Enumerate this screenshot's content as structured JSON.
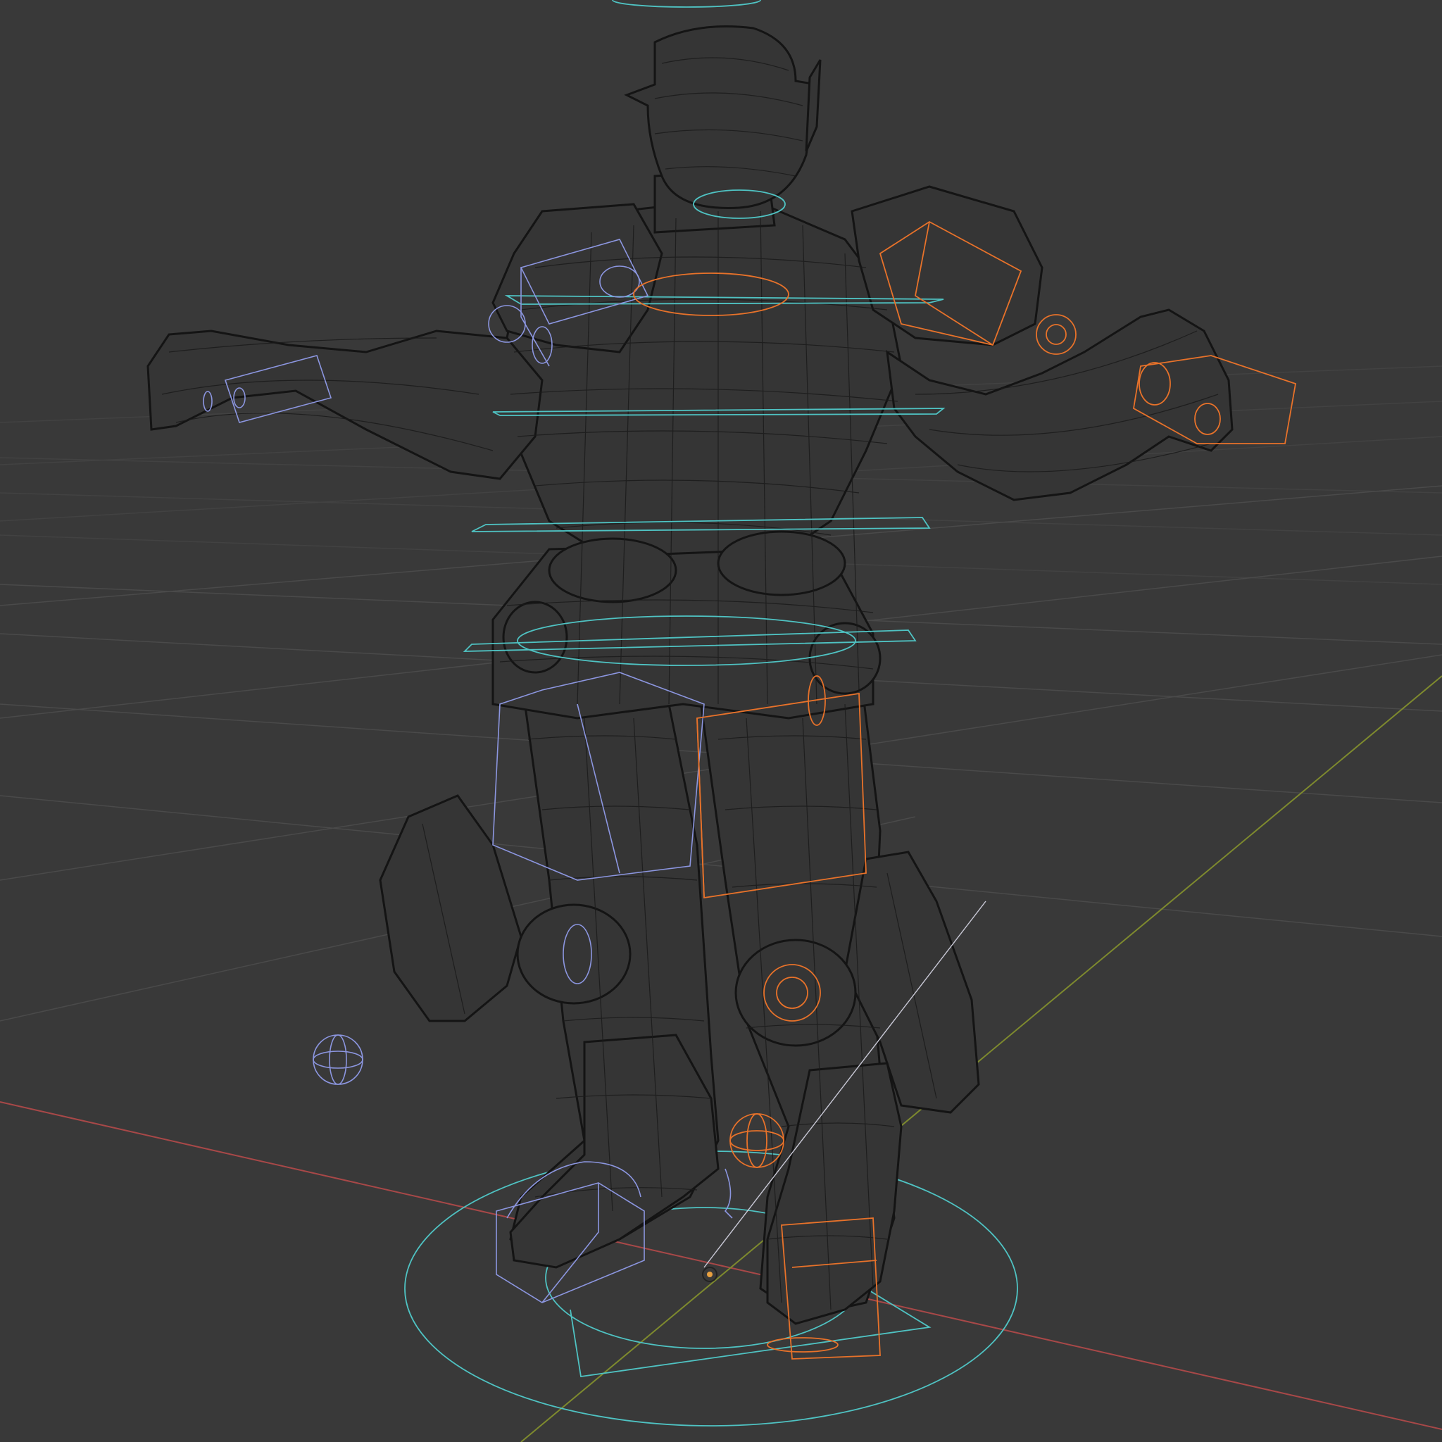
{
  "viewport": {
    "shading_mode": "wireframe",
    "background_color": "#393939",
    "grid_color": "#4a4a4a",
    "axis_colors": {
      "x": "#a84848",
      "y": "#7e8a2e"
    },
    "mesh_wire_color": "#141414",
    "control_colors": {
      "center": "#4fc3c3",
      "left": "#8c96e0",
      "right": "#e8722a"
    }
  },
  "scene_objects": [
    {
      "name": "character-mesh",
      "kind": "wireframe mesh"
    },
    {
      "name": "rig-root-control",
      "kind": "circle control"
    },
    {
      "name": "rig-spine-controls",
      "kind": "circle controls"
    },
    {
      "name": "rig-left-controls",
      "kind": "box/circle controls"
    },
    {
      "name": "rig-right-controls",
      "kind": "box/circle controls"
    },
    {
      "name": "origin-marker",
      "kind": "object origin"
    }
  ]
}
